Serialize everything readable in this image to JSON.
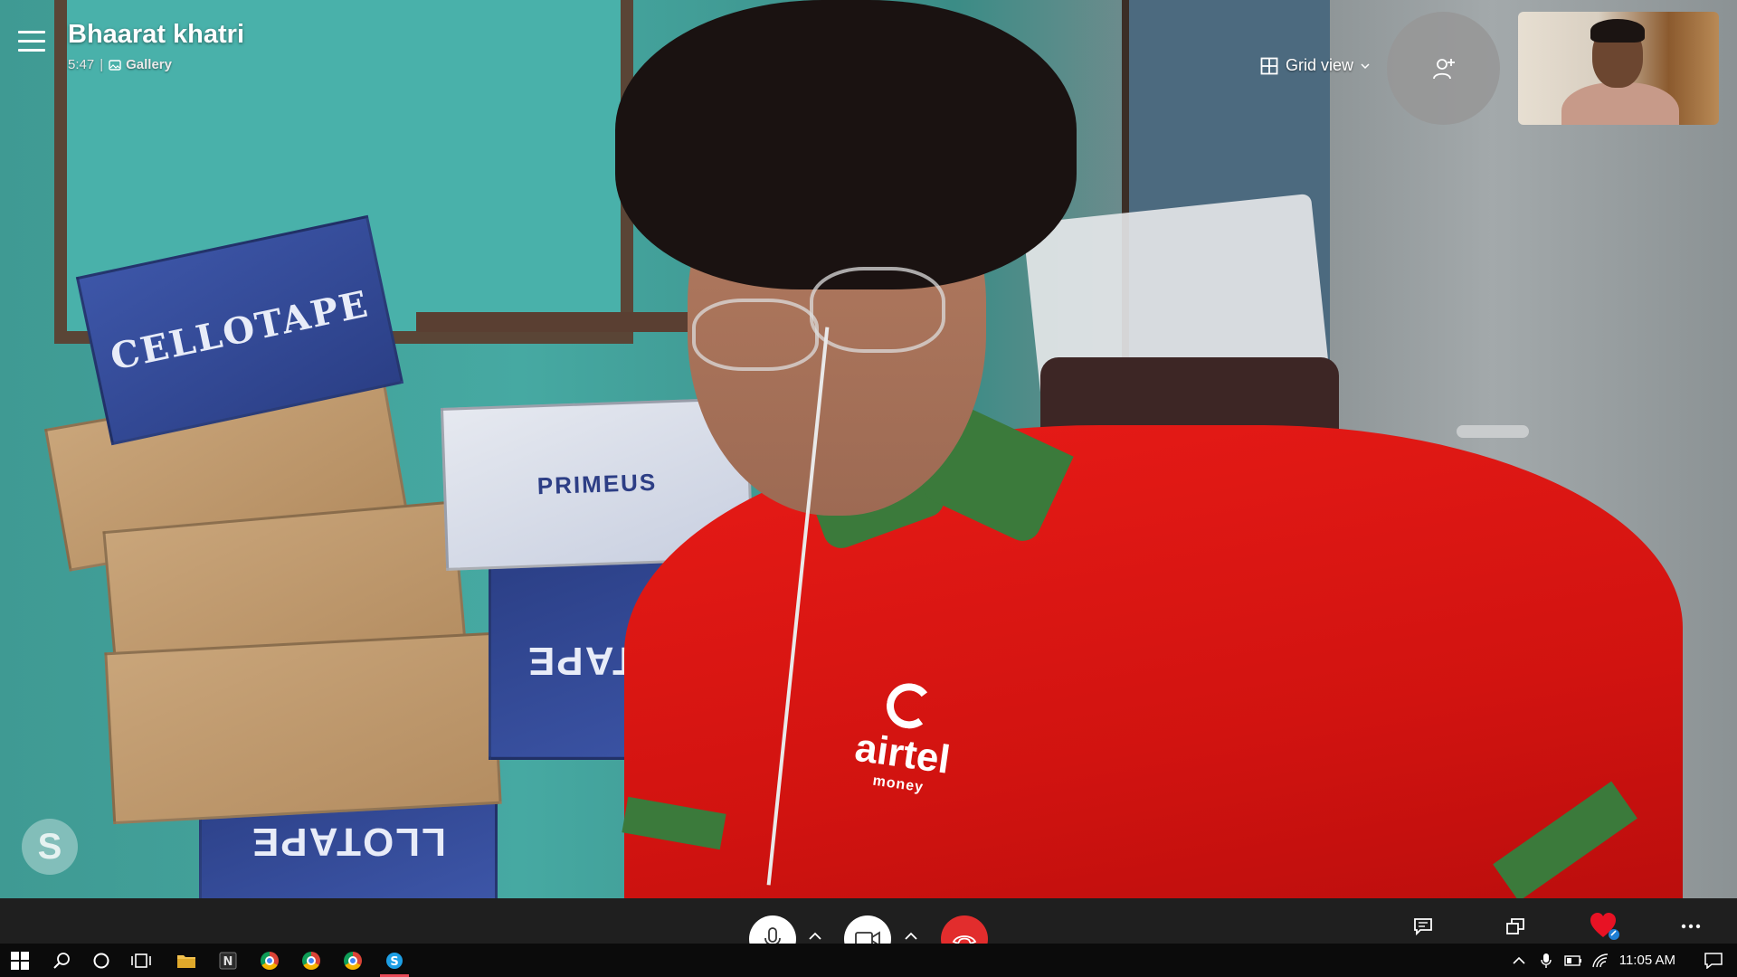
{
  "call": {
    "contact_name": "Bhaarat khatri",
    "duration": "5:47",
    "separator": "|",
    "view_label": "Gallery"
  },
  "top_controls": {
    "grid_view_label": "Grid view",
    "add_people_icon": "add-person-icon"
  },
  "video_text": {
    "box_top": "CELLOTAPE",
    "box_middle": "PRIMEUS",
    "box_low": "LLOTAPE",
    "box_bottom": "LLOTAPE",
    "shirt_brand": "airtel",
    "shirt_sub": "money"
  },
  "call_controls": {
    "mic_icon": "microphone-icon",
    "video_icon": "video-camera-icon",
    "hangup_icon": "hang-up-icon",
    "chat_icon": "chat-icon",
    "switch_icon": "switch-screen-icon",
    "react_icon": "heart-icon",
    "more_icon": "more-options-icon"
  },
  "taskbar": {
    "apps": [
      "windows-start",
      "search",
      "cortana",
      "task-view",
      "file-explorer",
      "notion",
      "chrome",
      "chrome",
      "chrome",
      "skype"
    ],
    "active_app": "skype",
    "time": "11:05 AM"
  },
  "colors": {
    "hangup": "#e22d2d",
    "heart": "#e81224",
    "taskbar": "#0b0b0b",
    "controls_bar": "#1f1f1f"
  }
}
